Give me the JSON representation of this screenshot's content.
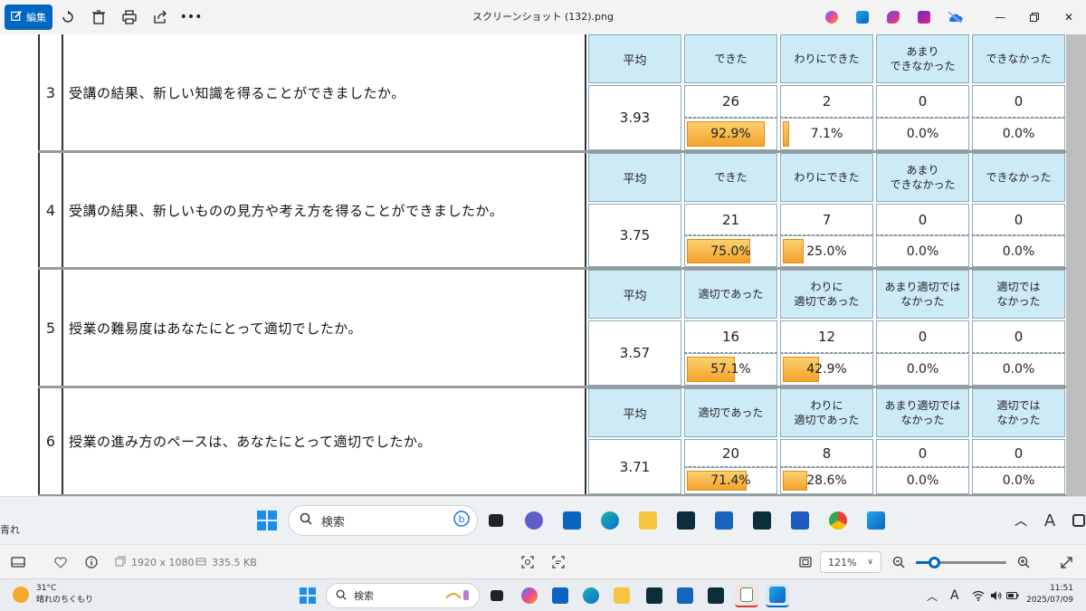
{
  "titlebar": {
    "edit_label": "編集",
    "window_title": "スクリーンショット (132).png"
  },
  "survey_rows": [
    {
      "number": "3",
      "question": "受講の結果、新しい知識を得ることができましたか。",
      "avg_label": "平均",
      "avg_value": "3.93",
      "options": [
        {
          "label": "できた",
          "count": "26",
          "percent": "92.9%",
          "fraction": 0.929
        },
        {
          "label": "わりにできた",
          "count": "2",
          "percent": "7.1%",
          "fraction": 0.071
        },
        {
          "label": "あまり\nできなかった",
          "count": "0",
          "percent": "0.0%",
          "fraction": 0
        },
        {
          "label": "できなかった",
          "count": "0",
          "percent": "0.0%",
          "fraction": 0
        }
      ]
    },
    {
      "number": "4",
      "question": "受講の結果、新しいものの見方や考え方を得ることができましたか。",
      "avg_label": "平均",
      "avg_value": "3.75",
      "options": [
        {
          "label": "できた",
          "count": "21",
          "percent": "75.0%",
          "fraction": 0.75
        },
        {
          "label": "わりにできた",
          "count": "7",
          "percent": "25.0%",
          "fraction": 0.25
        },
        {
          "label": "あまり\nできなかった",
          "count": "0",
          "percent": "0.0%",
          "fraction": 0
        },
        {
          "label": "できなかった",
          "count": "0",
          "percent": "0.0%",
          "fraction": 0
        }
      ]
    },
    {
      "number": "5",
      "question": "授業の難易度はあなたにとって適切でしたか。",
      "avg_label": "平均",
      "avg_value": "3.57",
      "options": [
        {
          "label": "適切であった",
          "count": "16",
          "percent": "57.1%",
          "fraction": 0.571
        },
        {
          "label": "わりに\n適切であった",
          "count": "12",
          "percent": "42.9%",
          "fraction": 0.429
        },
        {
          "label": "あまり適切では\nなかった",
          "count": "0",
          "percent": "0.0%",
          "fraction": 0
        },
        {
          "label": "適切では\nなかった",
          "count": "0",
          "percent": "0.0%",
          "fraction": 0
        }
      ]
    },
    {
      "number": "6",
      "question": "授業の進み方のペースは、あなたにとって適切でしたか。",
      "avg_label": "平均",
      "avg_value": "3.71",
      "options": [
        {
          "label": "適切であった",
          "count": "20",
          "percent": "71.4%",
          "fraction": 0.714
        },
        {
          "label": "わりに\n適切であった",
          "count": "8",
          "percent": "28.6%",
          "fraction": 0.286
        },
        {
          "label": "あまり適切では\nなかった",
          "count": "0",
          "percent": "0.0%",
          "fraction": 0
        },
        {
          "label": "適切では\nなかった",
          "count": "0",
          "percent": "0.0%",
          "fraction": 0
        }
      ]
    }
  ],
  "inner_taskbar": {
    "left_text": "青れ",
    "search_placeholder": "検索"
  },
  "infobar": {
    "dimensions": "1920 x 1080",
    "file_size": "335.5 KB",
    "zoom_value": "121%",
    "zoom_fraction": 0.2
  },
  "taskbar": {
    "temperature": "31°C",
    "weather_text": "晴れのちくもり",
    "search_placeholder": "検索",
    "time": "11:51",
    "date": "2025/07/09",
    "ime": "A"
  },
  "colors": {
    "accent": "#0067c0",
    "header_bg": "#cdeaf7",
    "bar_fill": "#f3a22a"
  }
}
